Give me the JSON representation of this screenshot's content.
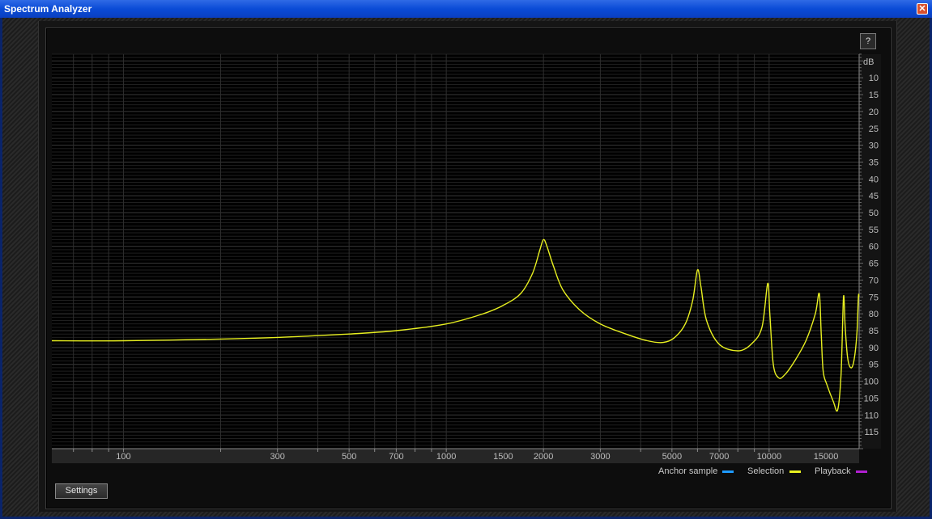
{
  "window": {
    "title": "Spectrum Analyzer",
    "close_glyph": "✕"
  },
  "toolbar": {
    "help_label": "?",
    "settings_label": "Settings"
  },
  "legend": [
    {
      "label": "Anchor sample",
      "color": "#1e9bff"
    },
    {
      "label": "Selection",
      "color": "#e8f020"
    },
    {
      "label": "Playback",
      "color": "#b020d0"
    }
  ],
  "chart_data": {
    "type": "line",
    "xscale": "log",
    "xlim": [
      60,
      19000
    ],
    "ylim": [
      120,
      3
    ],
    "ylabel": "dB",
    "x_ticks": [
      100,
      300,
      500,
      700,
      1000,
      1500,
      2000,
      3000,
      5000,
      7000,
      10000,
      15000
    ],
    "y_ticks": [
      10,
      15,
      20,
      25,
      30,
      35,
      40,
      45,
      50,
      55,
      60,
      65,
      70,
      75,
      80,
      85,
      90,
      95,
      100,
      105,
      110,
      115
    ],
    "grid": true,
    "series": [
      {
        "name": "Selection",
        "color": "#e8f020",
        "x": [
          60,
          100,
          200,
          300,
          500,
          700,
          1000,
          1300,
          1500,
          1700,
          1850,
          1950,
          2000,
          2050,
          2150,
          2300,
          2600,
          3000,
          3600,
          4200,
          4700,
          5100,
          5500,
          5800,
          6000,
          6150,
          6400,
          7000,
          8000,
          8800,
          9500,
          9900,
          10050,
          10300,
          10700,
          11200,
          12000,
          13000,
          13900,
          14300,
          14500,
          14700,
          15100,
          15800,
          16300,
          16700,
          17000,
          17200,
          17500,
          17900,
          18300,
          18700,
          18900,
          19000
        ],
        "values": [
          88,
          88,
          87.5,
          87,
          86,
          85,
          83,
          80,
          77.5,
          74,
          68,
          61,
          58,
          60,
          66,
          73,
          79,
          83,
          86,
          88,
          88.5,
          87,
          83,
          76,
          67,
          72,
          82,
          89,
          91,
          89,
          84,
          71,
          80,
          95,
          99,
          98,
          94,
          88,
          80,
          74,
          86,
          97,
          101,
          106,
          108.5,
          98,
          75,
          84,
          93,
          96,
          94,
          86,
          75,
          75
        ]
      }
    ]
  }
}
